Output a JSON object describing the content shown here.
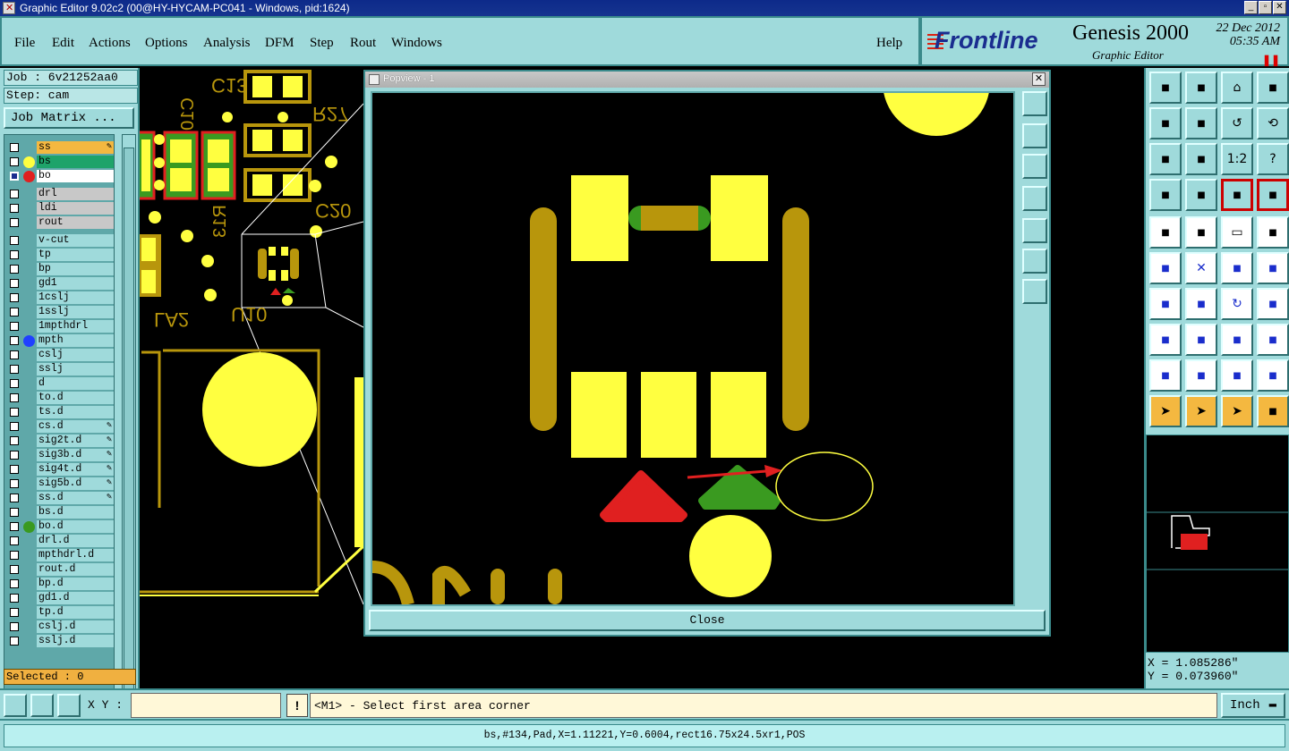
{
  "window": {
    "title": "Graphic Editor 9.02c2 (00@HY-HYCAM-PC041 - Windows, pid:1624)"
  },
  "menu": {
    "file": "File",
    "edit": "Edit",
    "actions": "Actions",
    "options": "Options",
    "analysis": "Analysis",
    "dfm": "DFM",
    "step": "Step",
    "rout": "Rout",
    "windows": "Windows",
    "help": "Help"
  },
  "brand": {
    "logo": "Frontline",
    "title": "Genesis 2000",
    "subtitle": "Graphic Editor",
    "date": "22 Dec 2012",
    "time": "05:35 AM",
    "stop_icon": "pause-icon"
  },
  "job": {
    "job_label": "Job : 6v21252aa0",
    "step_label": "Step: cam",
    "matrix_button": "Job Matrix ...",
    "selected": "Selected : 0"
  },
  "layers": [
    {
      "name": "ss",
      "bg": "#f4b840",
      "dot": "",
      "pen": true
    },
    {
      "name": "bs",
      "bg": "#1ea36a",
      "dot": "#ffff40",
      "pen": false
    },
    {
      "name": "bo",
      "bg": "#ffffff",
      "dot": "#e02020",
      "pen": false,
      "active": true
    },
    {
      "name": "drl",
      "bg": "#c8c8c8",
      "dot": "",
      "pen": false
    },
    {
      "name": "ldi",
      "bg": "#c8c8c8",
      "dot": "",
      "pen": false
    },
    {
      "name": "rout",
      "bg": "#c8c8c8",
      "dot": "",
      "pen": false
    },
    {
      "name": "v-cut",
      "bg": "",
      "dot": "",
      "pen": false
    },
    {
      "name": "tp",
      "bg": "",
      "dot": "",
      "pen": false
    },
    {
      "name": "bp",
      "bg": "",
      "dot": "",
      "pen": false
    },
    {
      "name": "gd1",
      "bg": "",
      "dot": "",
      "pen": false
    },
    {
      "name": "1cslj",
      "bg": "",
      "dot": "",
      "pen": false
    },
    {
      "name": "1sslj",
      "bg": "",
      "dot": "",
      "pen": false
    },
    {
      "name": "1mpthdrl",
      "bg": "",
      "dot": "",
      "pen": false
    },
    {
      "name": "mpth",
      "bg": "",
      "dot": "#2040ff",
      "pen": false
    },
    {
      "name": "cslj",
      "bg": "",
      "dot": "",
      "pen": false
    },
    {
      "name": "sslj",
      "bg": "",
      "dot": "",
      "pen": false
    },
    {
      "name": "d",
      "bg": "",
      "dot": "",
      "pen": false
    },
    {
      "name": "to.d",
      "bg": "",
      "dot": "",
      "pen": false
    },
    {
      "name": "ts.d",
      "bg": "",
      "dot": "",
      "pen": false
    },
    {
      "name": "cs.d",
      "bg": "",
      "dot": "",
      "pen": true
    },
    {
      "name": "sig2t.d",
      "bg": "",
      "dot": "",
      "pen": true
    },
    {
      "name": "sig3b.d",
      "bg": "",
      "dot": "",
      "pen": true
    },
    {
      "name": "sig4t.d",
      "bg": "",
      "dot": "",
      "pen": true
    },
    {
      "name": "sig5b.d",
      "bg": "",
      "dot": "",
      "pen": true
    },
    {
      "name": "ss.d",
      "bg": "",
      "dot": "",
      "pen": true
    },
    {
      "name": "bs.d",
      "bg": "",
      "dot": "",
      "pen": false
    },
    {
      "name": "bo.d",
      "bg": "",
      "dot": "#3a9a20",
      "pen": false
    },
    {
      "name": "drl.d",
      "bg": "",
      "dot": "",
      "pen": false
    },
    {
      "name": "mpthdrl.d",
      "bg": "",
      "dot": "",
      "pen": false
    },
    {
      "name": "rout.d",
      "bg": "",
      "dot": "",
      "pen": false
    },
    {
      "name": "bp.d",
      "bg": "",
      "dot": "",
      "pen": false
    },
    {
      "name": "gd1.d",
      "bg": "",
      "dot": "",
      "pen": false
    },
    {
      "name": "tp.d",
      "bg": "",
      "dot": "",
      "pen": false
    },
    {
      "name": "cslj.d",
      "bg": "",
      "dot": "",
      "pen": false
    },
    {
      "name": "sslj.d",
      "bg": "",
      "dot": "",
      "pen": false
    }
  ],
  "board_labels": {
    "c13": "C13",
    "c10": "C10",
    "r27": "R27",
    "c20": "C20",
    "r13": "R13",
    "la2": "LA2",
    "u10": "U10"
  },
  "popview": {
    "title": "Popview - 1",
    "close": "Close"
  },
  "coords": {
    "x": "X = 1.085286\"",
    "y": "Y = 0.073960\""
  },
  "command": {
    "xy_label": "X Y :",
    "xy_value": "",
    "warn_icon": "!",
    "message": "<M1> - Select first area corner",
    "unit": "Inch"
  },
  "status": {
    "text": "bs,#134,Pad,X=1.11221,Y=0.6004,rect16.75x24.5xr1,POS"
  },
  "colors": {
    "panel": "#9fdadb",
    "board_pad": "#ffff40",
    "board_trace": "#b8960c",
    "board_red": "#e02020",
    "board_green": "#3a9a20"
  }
}
